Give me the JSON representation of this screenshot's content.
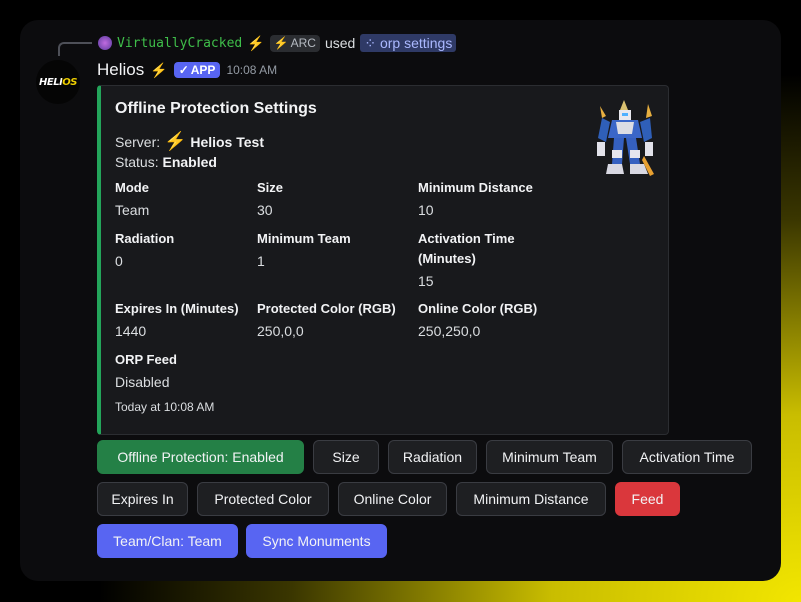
{
  "reply": {
    "username": "VirtuallyCracked",
    "tag_label": "ARC",
    "used_text": "used",
    "command": "orp settings"
  },
  "message": {
    "bot_name": "Helios",
    "app_label": "APP",
    "timestamp": "10:08 AM",
    "avatar_text": "HELIOS"
  },
  "embed": {
    "accent_color": "#23a55a",
    "title": "Offline Protection Settings",
    "server_label": "Server:",
    "server_value": "Helios Test",
    "status_label": "Status:",
    "status_value": "Enabled",
    "fields": [
      {
        "name": "Mode",
        "value": "Team"
      },
      {
        "name": "Size",
        "value": "30"
      },
      {
        "name": "Minimum Distance",
        "value": "10"
      },
      {
        "name": "Radiation",
        "value": "0"
      },
      {
        "name": "Minimum Team",
        "value": "1"
      },
      {
        "name": "Activation Time (Minutes)",
        "value": "15"
      },
      {
        "name": "Expires In (Minutes)",
        "value": "1440"
      },
      {
        "name": "Protected Color (RGB)",
        "value": "250,0,0"
      },
      {
        "name": "Online Color (RGB)",
        "value": "250,250,0"
      },
      {
        "name": "ORP Feed",
        "value": "Disabled"
      }
    ],
    "footer": "Today at 10:08 AM"
  },
  "buttons": [
    {
      "label": "Offline Protection: Enabled",
      "style": "green"
    },
    {
      "label": "Size",
      "style": "secondary"
    },
    {
      "label": "Radiation",
      "style": "secondary"
    },
    {
      "label": "Minimum Team",
      "style": "secondary"
    },
    {
      "label": "Activation Time",
      "style": "secondary"
    },
    {
      "label": "Expires In",
      "style": "secondary"
    },
    {
      "label": "Protected Color",
      "style": "secondary"
    },
    {
      "label": "Online Color",
      "style": "secondary"
    },
    {
      "label": "Minimum Distance",
      "style": "secondary"
    },
    {
      "label": "Feed",
      "style": "red"
    },
    {
      "label": "Team/Clan: Team",
      "style": "blurple"
    },
    {
      "label": "Sync Monuments",
      "style": "blurple"
    }
  ],
  "colors": {
    "green": "#248046",
    "red": "#da373c",
    "blurple": "#5865f2"
  }
}
